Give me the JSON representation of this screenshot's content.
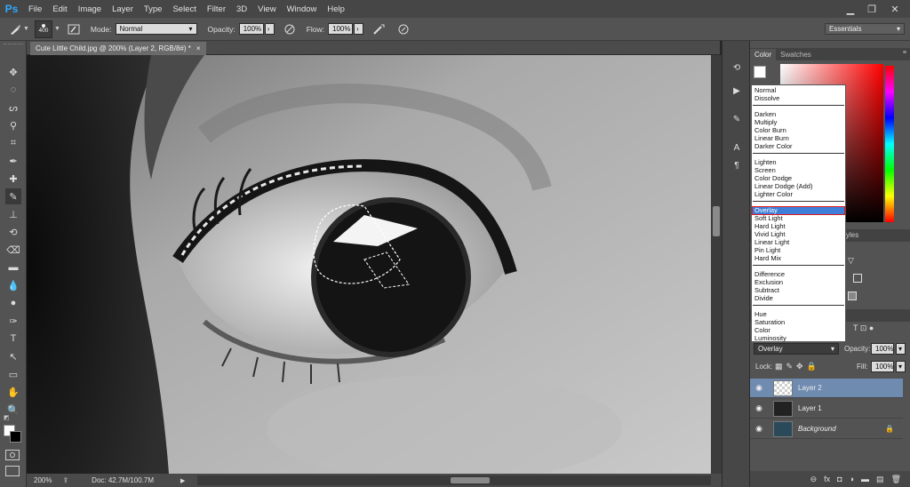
{
  "app": {
    "logo": "Ps"
  },
  "menu": [
    "File",
    "Edit",
    "Image",
    "Layer",
    "Type",
    "Select",
    "Filter",
    "3D",
    "View",
    "Window",
    "Help"
  ],
  "window_controls": {
    "minimize": "▁",
    "restore": "❐",
    "close": "✕"
  },
  "options_bar": {
    "brush_size": "400",
    "mode_label": "Mode:",
    "mode_value": "Normal",
    "opacity_label": "Opacity:",
    "opacity_value": "100%",
    "flow_label": "Flow:",
    "flow_value": "100%",
    "workspace": "Essentials"
  },
  "document": {
    "tab_title": "Cute Little Child.jpg @ 200% (Layer 2, RGB/8#) *",
    "close": "×"
  },
  "status": {
    "zoom": "200%",
    "doc_info": "Doc: 42.7M/100.7M"
  },
  "panels": {
    "color_tab": "Color",
    "swatches_tab": "Swatches",
    "styles_fragment": "yles"
  },
  "layers_panel": {
    "blend_mode": "Overlay",
    "opacity_label": "Opacity:",
    "opacity_value": "100%",
    "lock_label": "Lock:",
    "fill_label": "Fill:",
    "fill_value": "100%",
    "layers": [
      {
        "name": "Layer 2",
        "selected": true
      },
      {
        "name": "Layer 1",
        "selected": false
      },
      {
        "name": "Background",
        "selected": false
      }
    ]
  },
  "blend_menu": {
    "selected": "Overlay",
    "groups": [
      [
        "Normal",
        "Dissolve"
      ],
      [
        "Darken",
        "Multiply",
        "Color Burn",
        "Linear Burn",
        "Darker Color"
      ],
      [
        "Lighten",
        "Screen",
        "Color Dodge",
        "Linear Dodge (Add)",
        "Lighter Color"
      ],
      [
        "Overlay",
        "Soft Light",
        "Hard Light",
        "Vivid Light",
        "Linear Light",
        "Pin Light",
        "Hard Mix"
      ],
      [
        "Difference",
        "Exclusion",
        "Subtract",
        "Divide"
      ],
      [
        "Hue",
        "Saturation",
        "Color",
        "Luminosity"
      ]
    ]
  },
  "colors": {
    "accent_blue": "#31a8ff",
    "selection_highlight": "#3e7ed8",
    "highlight_border": "#e01a1a",
    "selected_layer_bg": "#6f8bb0"
  },
  "icons": {
    "tools": [
      "move-icon",
      "marquee-icon",
      "lasso-icon",
      "quick-select-icon",
      "crop-icon",
      "eyedropper-icon",
      "healing-icon",
      "brush-icon",
      "stamp-icon",
      "history-brush-icon",
      "eraser-icon",
      "gradient-icon",
      "blur-icon",
      "dodge-icon",
      "pen-icon",
      "type-icon",
      "path-select-icon",
      "shape-icon",
      "hand-icon",
      "zoom-icon"
    ]
  }
}
